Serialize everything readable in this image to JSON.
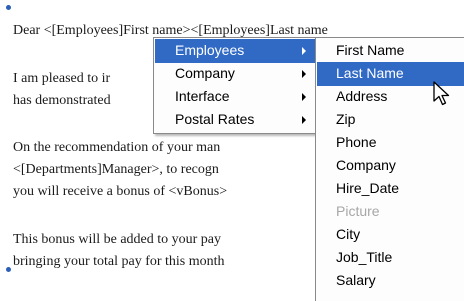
{
  "document": {
    "lines": [
      "Dear <[Employees]First name><[Employees]Last name",
      "I am pleased to ir",
      "has demonstrated",
      "On the recommendation of your man",
      "<[Departments]Manager>, to recogn",
      "you will receive a bonus of <vBonus>",
      "This bonus will be added to your pay",
      "bringing your total pay for this month"
    ]
  },
  "menu_main": {
    "items": [
      {
        "label": "Employees",
        "selected": true
      },
      {
        "label": "Company"
      },
      {
        "label": "Interface"
      },
      {
        "label": "Postal Rates"
      }
    ]
  },
  "menu_fields": {
    "items": [
      {
        "label": "First Name"
      },
      {
        "label": "Last Name",
        "selected": true
      },
      {
        "label": "Address"
      },
      {
        "label": "Zip"
      },
      {
        "label": "Phone"
      },
      {
        "label": "Company"
      },
      {
        "label": "Hire_Date"
      },
      {
        "label": "Picture",
        "disabled": true
      },
      {
        "label": "City"
      },
      {
        "label": "Job_Title"
      },
      {
        "label": "Salary"
      }
    ]
  },
  "colors": {
    "highlight": "#316ac5",
    "disabled_text": "#a7a7a7"
  },
  "icons": {
    "cursor": "arrow-pointer-icon",
    "submenu": "submenu-arrow-icon"
  }
}
